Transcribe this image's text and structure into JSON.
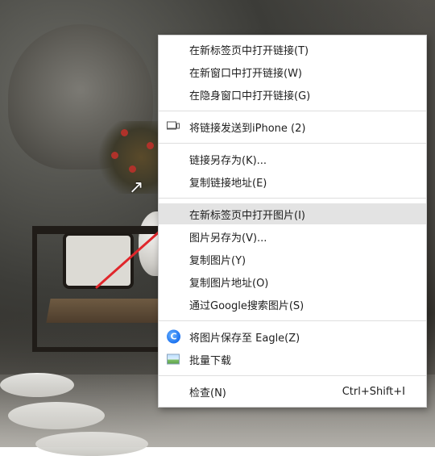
{
  "background": {
    "description_color_accent": "#b0322a"
  },
  "annotation": {
    "arrow_color": "#e0262b"
  },
  "context_menu": {
    "groups": [
      [
        {
          "label": "在新标签页中打开链接(T)"
        },
        {
          "label": "在新窗口中打开链接(W)"
        },
        {
          "label": "在隐身窗口中打开链接(G)"
        }
      ],
      [
        {
          "label": "将链接发送到iPhone (2)",
          "icon": "send-to-device-icon"
        }
      ],
      [
        {
          "label": "链接另存为(K)..."
        },
        {
          "label": "复制链接地址(E)"
        }
      ],
      [
        {
          "label": "在新标签页中打开图片(I)",
          "highlighted": true
        },
        {
          "label": "图片另存为(V)..."
        },
        {
          "label": "复制图片(Y)"
        },
        {
          "label": "复制图片地址(O)"
        },
        {
          "label": "通过Google搜索图片(S)"
        }
      ],
      [
        {
          "label": "将图片保存至 Eagle(Z)",
          "icon": "eagle-icon"
        },
        {
          "label": "批量下载",
          "icon": "image-download-icon"
        }
      ],
      [
        {
          "label": "检查(N)",
          "shortcut": "Ctrl+Shift+I"
        }
      ]
    ]
  }
}
